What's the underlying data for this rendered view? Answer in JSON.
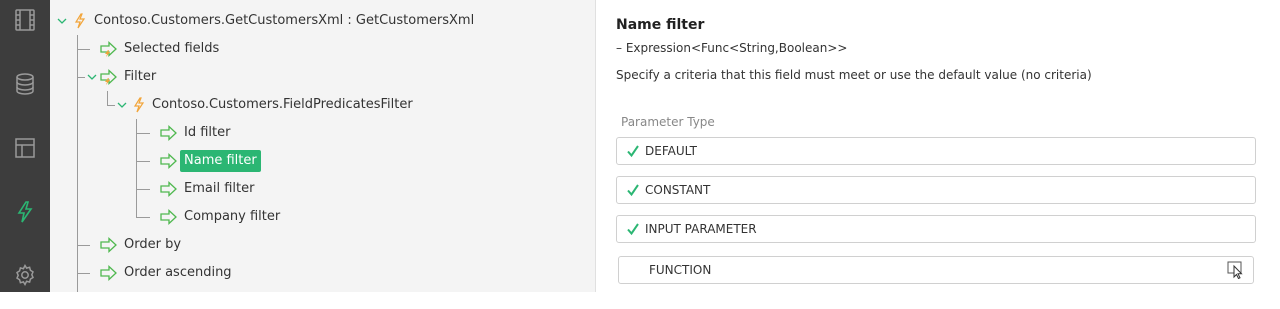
{
  "rail": {
    "items": [
      {
        "icon": "film-icon"
      },
      {
        "icon": "database-icon"
      },
      {
        "icon": "table-layout-icon"
      },
      {
        "icon": "lightning-icon",
        "active": true
      },
      {
        "icon": "gear-icon"
      }
    ]
  },
  "tree": {
    "root_label": "Contoso.Customers.GetCustomersXml : GetCustomersXml",
    "selected_fields_label": "Selected fields",
    "filter_label": "Filter",
    "predicates_label": "Contoso.Customers.FieldPredicatesFilter",
    "id_filter_label": "Id filter",
    "name_filter_label": "Name filter",
    "email_filter_label": "Email filter",
    "company_filter_label": "Company filter",
    "order_by_label": "Order by",
    "order_ascending_label": "Order ascending"
  },
  "detail": {
    "title": "Name filter",
    "type_text": "– Expression<Func<String,Boolean>>",
    "description": "Specify a criteria that this field must meet or use the default value (no criteria)",
    "section_label": "Parameter Type",
    "options": [
      {
        "label": "DEFAULT",
        "checked": true
      },
      {
        "label": "CONSTANT",
        "checked": true
      },
      {
        "label": "INPUT PARAMETER",
        "checked": true
      },
      {
        "label": "FUNCTION",
        "checked": false
      }
    ]
  },
  "colors": {
    "accent": "#2bb673",
    "rail_bg": "#3d3d3d",
    "tree_bg": "#f4f4f4",
    "lightning": "#f2a53a"
  }
}
